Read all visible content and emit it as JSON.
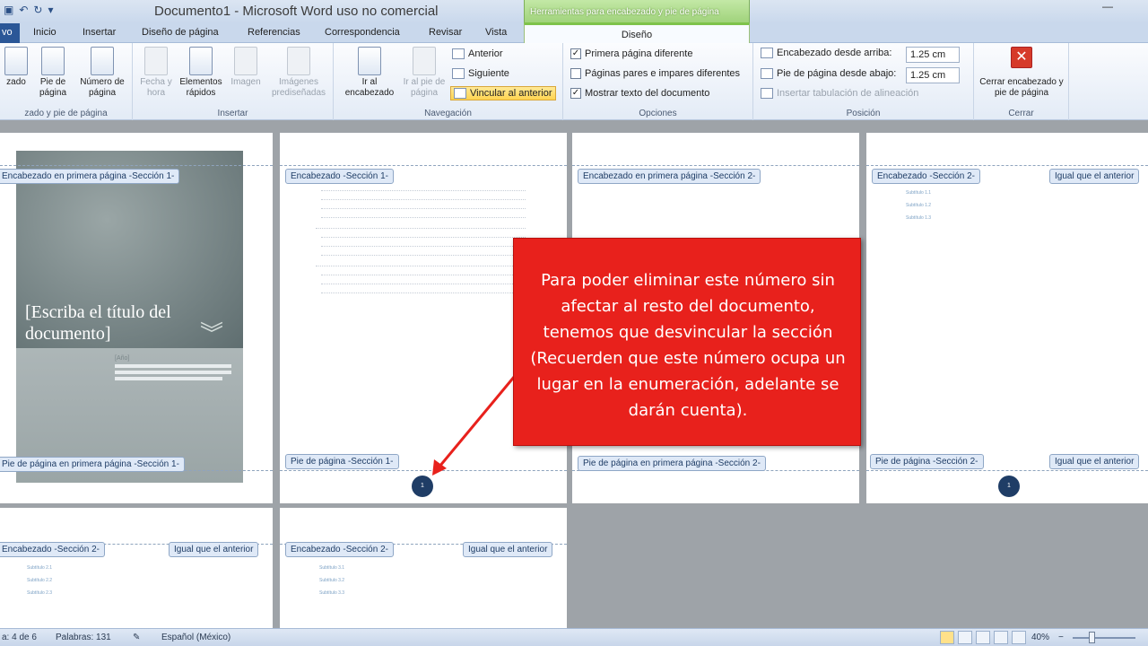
{
  "titlebar": {
    "doc_title": "Documento1 - Microsoft Word uso no comercial",
    "context_title": "Herramientas para encabezado y pie de página"
  },
  "tabs": {
    "file": "vo",
    "items": [
      "Inicio",
      "Insertar",
      "Diseño de página",
      "Referencias",
      "Correspondencia",
      "Revisar",
      "Vista"
    ],
    "design": "Diseño"
  },
  "ribbon": {
    "hf_group": {
      "header": "zado",
      "footer": "Pie de página",
      "page_number": "Número de página",
      "label": "zado y pie de página"
    },
    "insert_group": {
      "datetime": "Fecha y hora",
      "quickparts": "Elementos rápidos",
      "image": "Imagen",
      "clipart": "Imágenes prediseñadas",
      "label": "Insertar"
    },
    "nav_group": {
      "goto_header": "Ir al encabezado",
      "goto_footer": "Ir al pie de página",
      "previous": "Anterior",
      "next": "Siguiente",
      "link_previous": "Vincular al anterior",
      "label": "Navegación"
    },
    "options_group": {
      "first_page": "Primera página diferente",
      "odd_even": "Páginas pares e impares diferentes",
      "show_text": "Mostrar texto del documento",
      "label": "Opciones"
    },
    "position_group": {
      "header_top": "Encabezado desde arriba:",
      "header_top_val": "1.25 cm",
      "footer_bottom": "Pie de página desde abajo:",
      "footer_bottom_val": "1.25 cm",
      "align_tab": "Insertar tabulación de alineación",
      "label": "Posición"
    },
    "close_group": {
      "close": "Cerrar encabezado y pie de página",
      "label": "Cerrar"
    }
  },
  "pages": {
    "p1": {
      "header": "Encabezado en primera página -Sección 1-",
      "footer": "Pie de página en primera página -Sección 1-",
      "cover_title": "[Escriba el título del documento]",
      "cover_sub": "[Año]"
    },
    "p2": {
      "header": "Encabezado -Sección 1-",
      "footer": "Pie de página -Sección 1-",
      "page_num": "1"
    },
    "p3": {
      "header": "Encabezado en primera página -Sección 2-",
      "footer": "Pie de página en primera página -Sección 2-"
    },
    "p4": {
      "header": "Encabezado -Sección 2-",
      "same_header": "Igual que el anterior",
      "footer": "Pie de página -Sección 2-",
      "same_footer": "Igual que el anterior",
      "page_num": "1",
      "subs": [
        "Subtítulo 1.1",
        "Subtítulo 1.2",
        "Subtítulo 1.3"
      ]
    },
    "p5": {
      "header": "Encabezado -Sección 2-",
      "same_header": "Igual que el anterior",
      "subs": [
        "Subtítulo 2.1",
        "Subtítulo 2.2",
        "Subtítulo 2.3"
      ]
    },
    "p6": {
      "header": "Encabezado -Sección 2-",
      "same_header": "Igual que el anterior",
      "subs": [
        "Subtítulo 3.1",
        "Subtítulo 3.2",
        "Subtítulo 3.3"
      ]
    }
  },
  "callout": {
    "text": "Para poder eliminar este número sin afectar al resto del documento, tenemos que desvincular la sección (Recuerden que este número ocupa un lugar en la enumeración, adelante se darán cuenta).",
    "color": "#e8211c"
  },
  "status": {
    "page": "a: 4 de 6",
    "words": "Palabras: 131",
    "language": "Español (México)",
    "zoom": "40%"
  }
}
